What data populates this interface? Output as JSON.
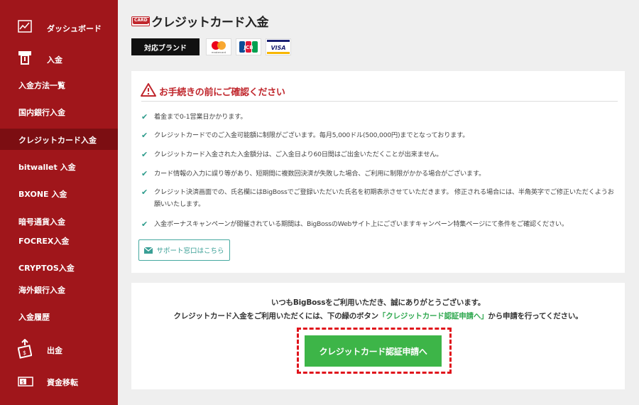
{
  "sidebar": {
    "dashboard": "ダッシュボード",
    "deposit": "入金",
    "deposit_methods": "入金方法一覧",
    "domestic_bank": "国内銀行入金",
    "credit_card": "クレジットカード入金",
    "bitwallet": "bitwallet 入金",
    "bxone": "BXONE 入金",
    "crypto": "暗号通貨入金",
    "focrex": "FOCREX入金",
    "cryptos": "CRYPTOS入金",
    "overseas_bank": "海外銀行入金",
    "history": "入金履歴",
    "withdraw": "出金",
    "transfer": "資金移転"
  },
  "header": {
    "card_icon_text": "CARD",
    "title": "クレジットカード入金"
  },
  "brands": {
    "label": "対応ブランド",
    "mastercard_text": "mastercard",
    "jcb_text": "JCB",
    "visa_text": "VISA"
  },
  "notice": {
    "title": "お手続きの前にご確認ください",
    "items": [
      "着金まで0-1営業日かかります。",
      "クレジットカードでのご入金可能額に制限がございます。毎月5,000ドル(500,000円)までとなっております。",
      "クレジットカード入金された入金額分は、ご入金日より60日間はご出金いただくことが出来ません。",
      "カード情報の入力に誤り等があり、短期間に複数回決済が失敗した場合、ご利用に制限がかかる場合がございます。",
      "クレジット決済画面での、氏名欄にはBigBossでご登録いただいた氏名を初期表示させていただきます。 修正される場合には、半角英字でご修正いただくようお願いいたします。",
      "入金ボーナスキャンペーンが開催されている期間は、BigBossのWebサイト上にございますキャンペーン特集ページにて条件をご確認ください。"
    ],
    "support_label": "サポート窓口はこちら"
  },
  "apply": {
    "line1": "いつもBigBossをご利用いただき、誠にありがとうございます。",
    "line2_pre": "クレジットカード入金をご利用いただくには、下の緑のボタン",
    "line2_highlight": "「クレジットカード認証申請へ」",
    "line2_post": "から申請を行ってください。",
    "button_label": "クレジットカード認証申請へ"
  },
  "colors": {
    "sidebar_bg": "#a0161b",
    "sidebar_active": "#7c0e12",
    "accent_red": "#c0272d",
    "teal": "#2e9c8c",
    "cta_green": "#3db548"
  }
}
